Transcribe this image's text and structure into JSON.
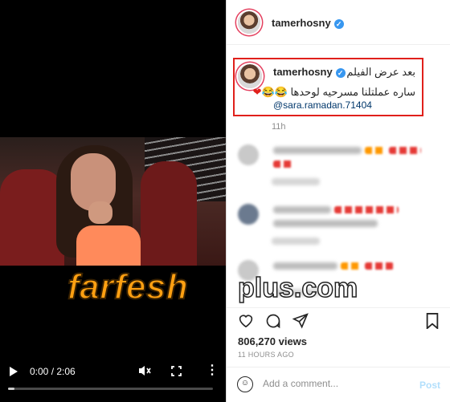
{
  "video": {
    "time": "0:00 / 2:06",
    "progress": 0.0,
    "controls": {
      "play_icon": "play-icon",
      "mute_icon": "muted-icon",
      "fullscreen_icon": "fullscreen-icon",
      "more_icon": "more-vertical-icon"
    }
  },
  "watermark": {
    "brand": "farfesh",
    "suffix": "plus.com"
  },
  "header": {
    "username": "tamerhosny"
  },
  "caption": {
    "username": "tamerhosny",
    "line1": "بعد عرض الفيلم",
    "line2": "ساره عملتلنا مسرحيه لوحدها",
    "mention": "@sara.ramadan.71404",
    "time": "11h"
  },
  "post": {
    "views": "806,270 views",
    "posted": "11 HOURS AGO"
  },
  "comment_box": {
    "placeholder": "Add a comment...",
    "post_label": "Post"
  },
  "colors": {
    "verified": "#3897f0",
    "highlight": "#e0201b",
    "watermark_orange": "#ffa012"
  }
}
